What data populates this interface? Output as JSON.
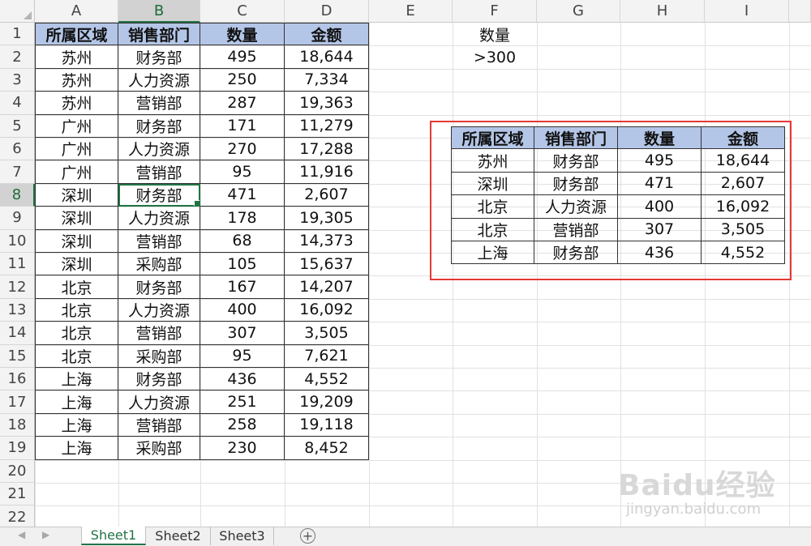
{
  "columns": [
    {
      "letter": "A",
      "w": 103
    },
    {
      "letter": "B",
      "w": 101
    },
    {
      "letter": "C",
      "w": 104
    },
    {
      "letter": "D",
      "w": 104
    },
    {
      "letter": "E",
      "w": 103
    },
    {
      "letter": "F",
      "w": 104
    },
    {
      "letter": "G",
      "w": 103
    },
    {
      "letter": "H",
      "w": 104
    },
    {
      "letter": "I",
      "w": 104
    }
  ],
  "selected_cell": {
    "col": "B",
    "row": "8"
  },
  "headers": [
    "所属区域",
    "销售部门",
    "数量",
    "金额"
  ],
  "rows": [
    [
      "苏州",
      "财务部",
      "495",
      "18,644"
    ],
    [
      "苏州",
      "人力资源",
      "250",
      "7,334"
    ],
    [
      "苏州",
      "营销部",
      "287",
      "19,363"
    ],
    [
      "广州",
      "财务部",
      "171",
      "11,279"
    ],
    [
      "广州",
      "人力资源",
      "270",
      "17,288"
    ],
    [
      "广州",
      "营销部",
      "95",
      "11,916"
    ],
    [
      "深圳",
      "财务部",
      "471",
      "2,607"
    ],
    [
      "深圳",
      "人力资源",
      "178",
      "19,305"
    ],
    [
      "深圳",
      "营销部",
      "68",
      "14,373"
    ],
    [
      "深圳",
      "采购部",
      "105",
      "15,637"
    ],
    [
      "北京",
      "财务部",
      "167",
      "14,207"
    ],
    [
      "北京",
      "人力资源",
      "400",
      "16,092"
    ],
    [
      "北京",
      "营销部",
      "307",
      "3,505"
    ],
    [
      "北京",
      "采购部",
      "95",
      "7,621"
    ],
    [
      "上海",
      "财务部",
      "436",
      "4,552"
    ],
    [
      "上海",
      "人力资源",
      "251",
      "19,209"
    ],
    [
      "上海",
      "营销部",
      "258",
      "19,118"
    ],
    [
      "上海",
      "采购部",
      "230",
      "8,452"
    ]
  ],
  "row_numbers": [
    "1",
    "2",
    "3",
    "4",
    "5",
    "6",
    "7",
    "8",
    "9",
    "10",
    "11",
    "12",
    "13",
    "14",
    "15",
    "16",
    "17",
    "18",
    "19",
    "20",
    "21",
    "22"
  ],
  "criteria": {
    "header": "数量",
    "value": ">300"
  },
  "result_headers": [
    "所属区域",
    "销售部门",
    "数量",
    "金额"
  ],
  "result_rows": [
    [
      "苏州",
      "财务部",
      "495",
      "18,644"
    ],
    [
      "深圳",
      "财务部",
      "471",
      "2,607"
    ],
    [
      "北京",
      "人力资源",
      "400",
      "16,092"
    ],
    [
      "北京",
      "营销部",
      "307",
      "3,505"
    ],
    [
      "上海",
      "财务部",
      "436",
      "4,552"
    ]
  ],
  "sheet_tabs": [
    {
      "label": "Sheet1",
      "active": true
    },
    {
      "label": "Sheet2",
      "active": false
    },
    {
      "label": "Sheet3",
      "active": false
    }
  ],
  "add_sheet_symbol": "+",
  "watermark": {
    "logo": "Baidu经验",
    "url": "jingyan.baidu.com"
  },
  "colors": {
    "header_fill": "#b4c6e7",
    "selection": "#217346",
    "highlight_box": "#e53935"
  }
}
